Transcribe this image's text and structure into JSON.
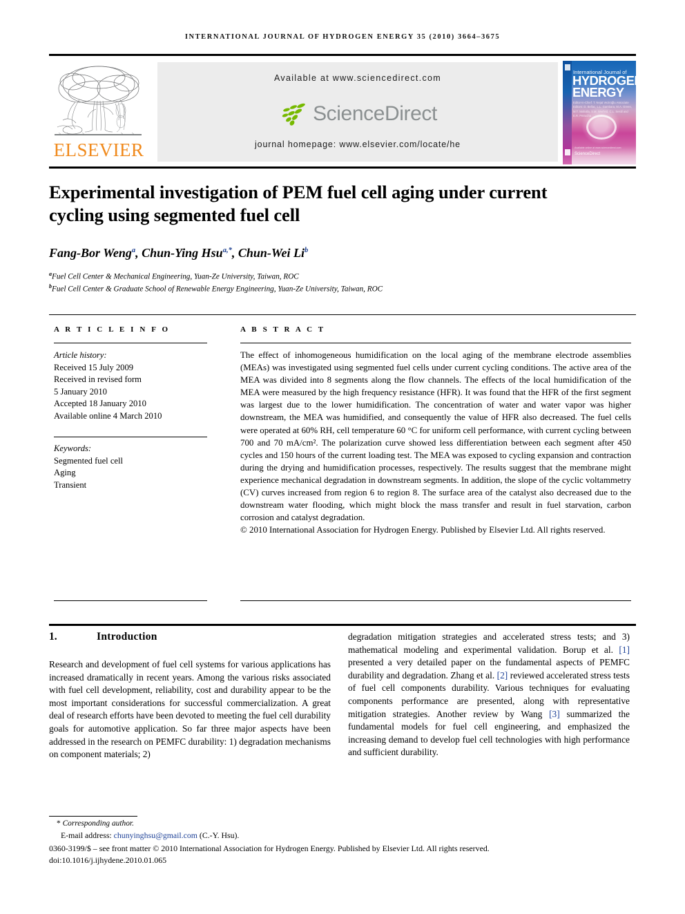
{
  "running_head": "INTERNATIONAL JOURNAL OF HYDROGEN ENERGY 35 (2010) 3664–3675",
  "masthead": {
    "publisher_wordmark": "ELSEVIER",
    "available_at": "Available at www.sciencedirect.com",
    "sciencedirect_wordmark": "ScienceDirect",
    "journal_homepage": "journal homepage: www.elsevier.com/locate/he",
    "cover": {
      "line_small": "International Journal of",
      "line_big_1": "HYDROGEN",
      "line_big_2": "ENERGY",
      "editors": "Editor-in-Chief: T. Nejat Veziroğlu   Associate Editors: D. Bellac, L.L. Gambara, M.A. Green, M.T. Mahalla, S.M. Werfeld, C.L. Sestil and E.R. Petrucha",
      "sciencedirect_label": "ScienceDirect",
      "sciencedirect_tagline": "Available online at www.sciencedirect.com"
    }
  },
  "article": {
    "title": "Experimental investigation of PEM fuel cell aging under current cycling using segmented fuel cell",
    "authors": [
      {
        "name": "Fang-Bor Weng",
        "marks": "a"
      },
      {
        "name": "Chun-Ying Hsu",
        "marks": "a,*"
      },
      {
        "name": "Chun-Wei Li",
        "marks": "b"
      }
    ],
    "affiliations": [
      {
        "mark": "a",
        "text": "Fuel Cell Center & Mechanical Engineering, Yuan-Ze University, Taiwan, ROC"
      },
      {
        "mark": "b",
        "text": "Fuel Cell Center & Graduate School of Renewable Energy Engineering, Yuan-Ze University, Taiwan, ROC"
      }
    ]
  },
  "article_info": {
    "heading": "A R T I C L E  I N F O",
    "history_label": "Article history:",
    "history": [
      "Received 15 July 2009",
      "Received in revised form",
      "5 January 2010",
      "Accepted 18 January 2010",
      "Available online 4 March 2010"
    ],
    "keywords_label": "Keywords:",
    "keywords": [
      "Segmented fuel cell",
      "Aging",
      "Transient"
    ]
  },
  "abstract": {
    "heading": "A B S T R A C T",
    "text": "The effect of inhomogeneous humidification on the local aging of the membrane electrode assemblies (MEAs) was investigated using segmented fuel cells under current cycling conditions. The active area of the MEA was divided into 8 segments along the flow channels. The effects of the local humidification of the MEA were measured by the high frequency resistance (HFR). It was found that the HFR of the first segment was largest due to the lower humidification. The concentration of water and water vapor was higher downstream, the MEA was humidified, and consequently the value of HFR also decreased. The fuel cells were operated at 60% RH, cell temperature 60 °C for uniform cell performance, with current cycling between 700 and 70 mA/cm². The polarization curve showed less differentiation between each segment after 450 cycles and 150 hours of the current loading test. The MEA was exposed to cycling expansion and contraction during the drying and humidification processes, respectively. The results suggest that the membrane might experience mechanical degradation in downstream segments. In addition, the slope of the cyclic voltammetry (CV) curves increased from region 6 to region 8. The surface area of the catalyst also decreased due to the downstream water flooding, which might block the mass transfer and result in fuel starvation, carbon corrosion and catalyst degradation.",
    "copyright": "© 2010 International Association for Hydrogen Energy. Published by Elsevier Ltd. All rights reserved."
  },
  "body": {
    "section_number": "1.",
    "section_title": "Introduction",
    "left_column": "Research and development of fuel cell systems for various applications has increased dramatically in recent years. Among the various risks associated with fuel cell development, reliability, cost and durability appear to be the most important considerations for successful commercialization. A great deal of research efforts have been devoted to meeting the fuel cell durability goals for automotive application. So far three major aspects have been addressed in the research on PEMFC durability: 1) degradation mechanisms on component materials; 2)",
    "right_column_part1": "degradation mitigation strategies and accelerated stress tests; and 3) mathematical modeling and experimental validation. Borup et al. ",
    "right_ref_1": "[1]",
    "right_column_part2": " presented a very detailed paper on the fundamental aspects of PEMFC durability and degradation. Zhang et al. ",
    "right_ref_2": "[2]",
    "right_column_part3": " reviewed accelerated stress tests of fuel cell components durability. Various techniques for evaluating components performance are presented, along with representative mitigation strategies. Another review by Wang ",
    "right_ref_3": "[3]",
    "right_column_part4": " summarized the fundamental models for fuel cell engineering, and emphasized the increasing demand to develop fuel cell technologies with high performance and sufficient durability."
  },
  "footnotes": {
    "corresponding_star": "*",
    "corresponding_text": "Corresponding author.",
    "email_label": "E-mail address: ",
    "email_address": "chunyinghsu@gmail.com",
    "email_suffix": " (C.-Y. Hsu).",
    "issn_line": "0360-3199/$ – see front matter © 2010 International Association for Hydrogen Energy. Published by Elsevier Ltd. All rights reserved.",
    "doi_line": "doi:10.1016/j.ijhydene.2010.01.065"
  },
  "colors": {
    "elsevier_orange": "#f08a1d",
    "link_blue": "#1b3f96",
    "banner_gray": "#ececec",
    "sciencedirect_green": "#6aa800",
    "sciencedirect_gray": "#8b9091"
  }
}
